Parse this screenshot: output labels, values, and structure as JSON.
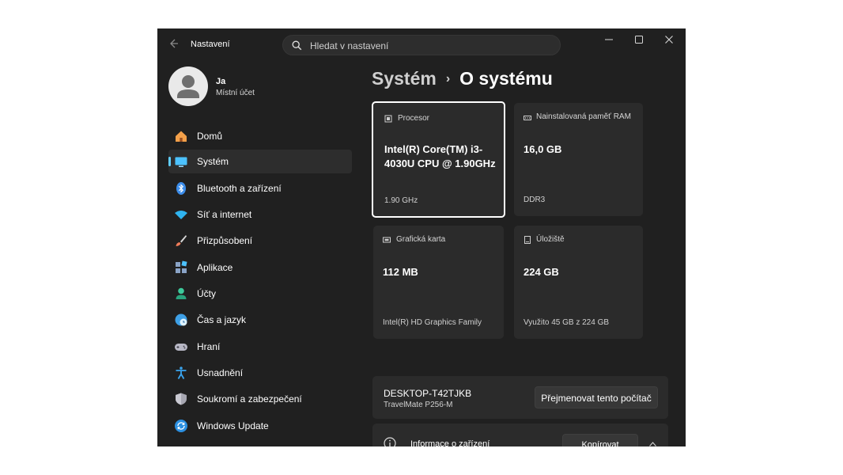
{
  "titlebar": {
    "back_icon": "back-arrow-icon",
    "title": "Nastavení",
    "search_placeholder": "Hledat v nastavení",
    "controls": [
      "minimize-icon",
      "maximize-icon",
      "close-icon"
    ]
  },
  "profile": {
    "name": "Ja",
    "account_type": "Místní účet",
    "avatar_icon": "person-icon"
  },
  "nav": {
    "items": [
      {
        "label": "Domů",
        "icon": "home-icon",
        "color": "#f3a04a"
      },
      {
        "label": "Systém",
        "icon": "system-display-icon",
        "color": "#4cc2ff",
        "active": true
      },
      {
        "label": "Bluetooth a zařízení",
        "icon": "bluetooth-icon",
        "color": "#3c8dea"
      },
      {
        "label": "Síť a internet",
        "icon": "wifi-icon",
        "color": "#2fb4f0"
      },
      {
        "label": "Přizpůsobení",
        "icon": "paintbrush-icon",
        "color": "#f07c5a"
      },
      {
        "label": "Aplikace",
        "icon": "apps-icon",
        "color": "#8aa3c6"
      },
      {
        "label": "Účty",
        "icon": "accounts-icon",
        "color": "#3dc99b"
      },
      {
        "label": "Čas a jazyk",
        "icon": "globe-clock-icon",
        "color": "#3ea0e6"
      },
      {
        "label": "Hraní",
        "icon": "gamepad-icon",
        "color": "#b7b7c4"
      },
      {
        "label": "Usnadnění",
        "icon": "accessibility-icon",
        "color": "#3aa5f0"
      },
      {
        "label": "Soukromí a zabezpečení",
        "icon": "shield-icon",
        "color": "#a7a7b2"
      },
      {
        "label": "Windows Update",
        "icon": "windows-update-icon",
        "color": "#2b8fe0"
      }
    ]
  },
  "breadcrumb": {
    "parent": "Systém",
    "separator": "›",
    "current": "O systému"
  },
  "specs": {
    "cpu": {
      "title": "Procesor",
      "value": "Intel(R) Core(TM) i3-4030U CPU @ 1.90GHz",
      "sub": "1.90 GHz",
      "icon": "processor-icon"
    },
    "ram": {
      "title": "Nainstalovaná paměť RAM",
      "value": "16,0 GB",
      "sub": "DDR3",
      "icon": "memory-icon"
    },
    "gpu": {
      "title": "Grafická karta",
      "value": "112 MB",
      "sub": "Intel(R) HD Graphics Family",
      "icon": "gpu-icon"
    },
    "storage": {
      "title": "Úložiště",
      "value": "224 GB",
      "sub": "Využito 45 GB z 224 GB",
      "icon": "storage-icon"
    }
  },
  "device": {
    "name": "DESKTOP-T42TJKB",
    "model": "TravelMate P256-M",
    "rename_label": "Přejmenovat tento počítač"
  },
  "device_info": {
    "label": "Informace o zařízení",
    "copy_label": "Kopírovat",
    "icon": "info-icon"
  },
  "colors": {
    "window_bg": "#202020",
    "card_bg": "#2b2b2b",
    "accent": "#60cdff"
  }
}
